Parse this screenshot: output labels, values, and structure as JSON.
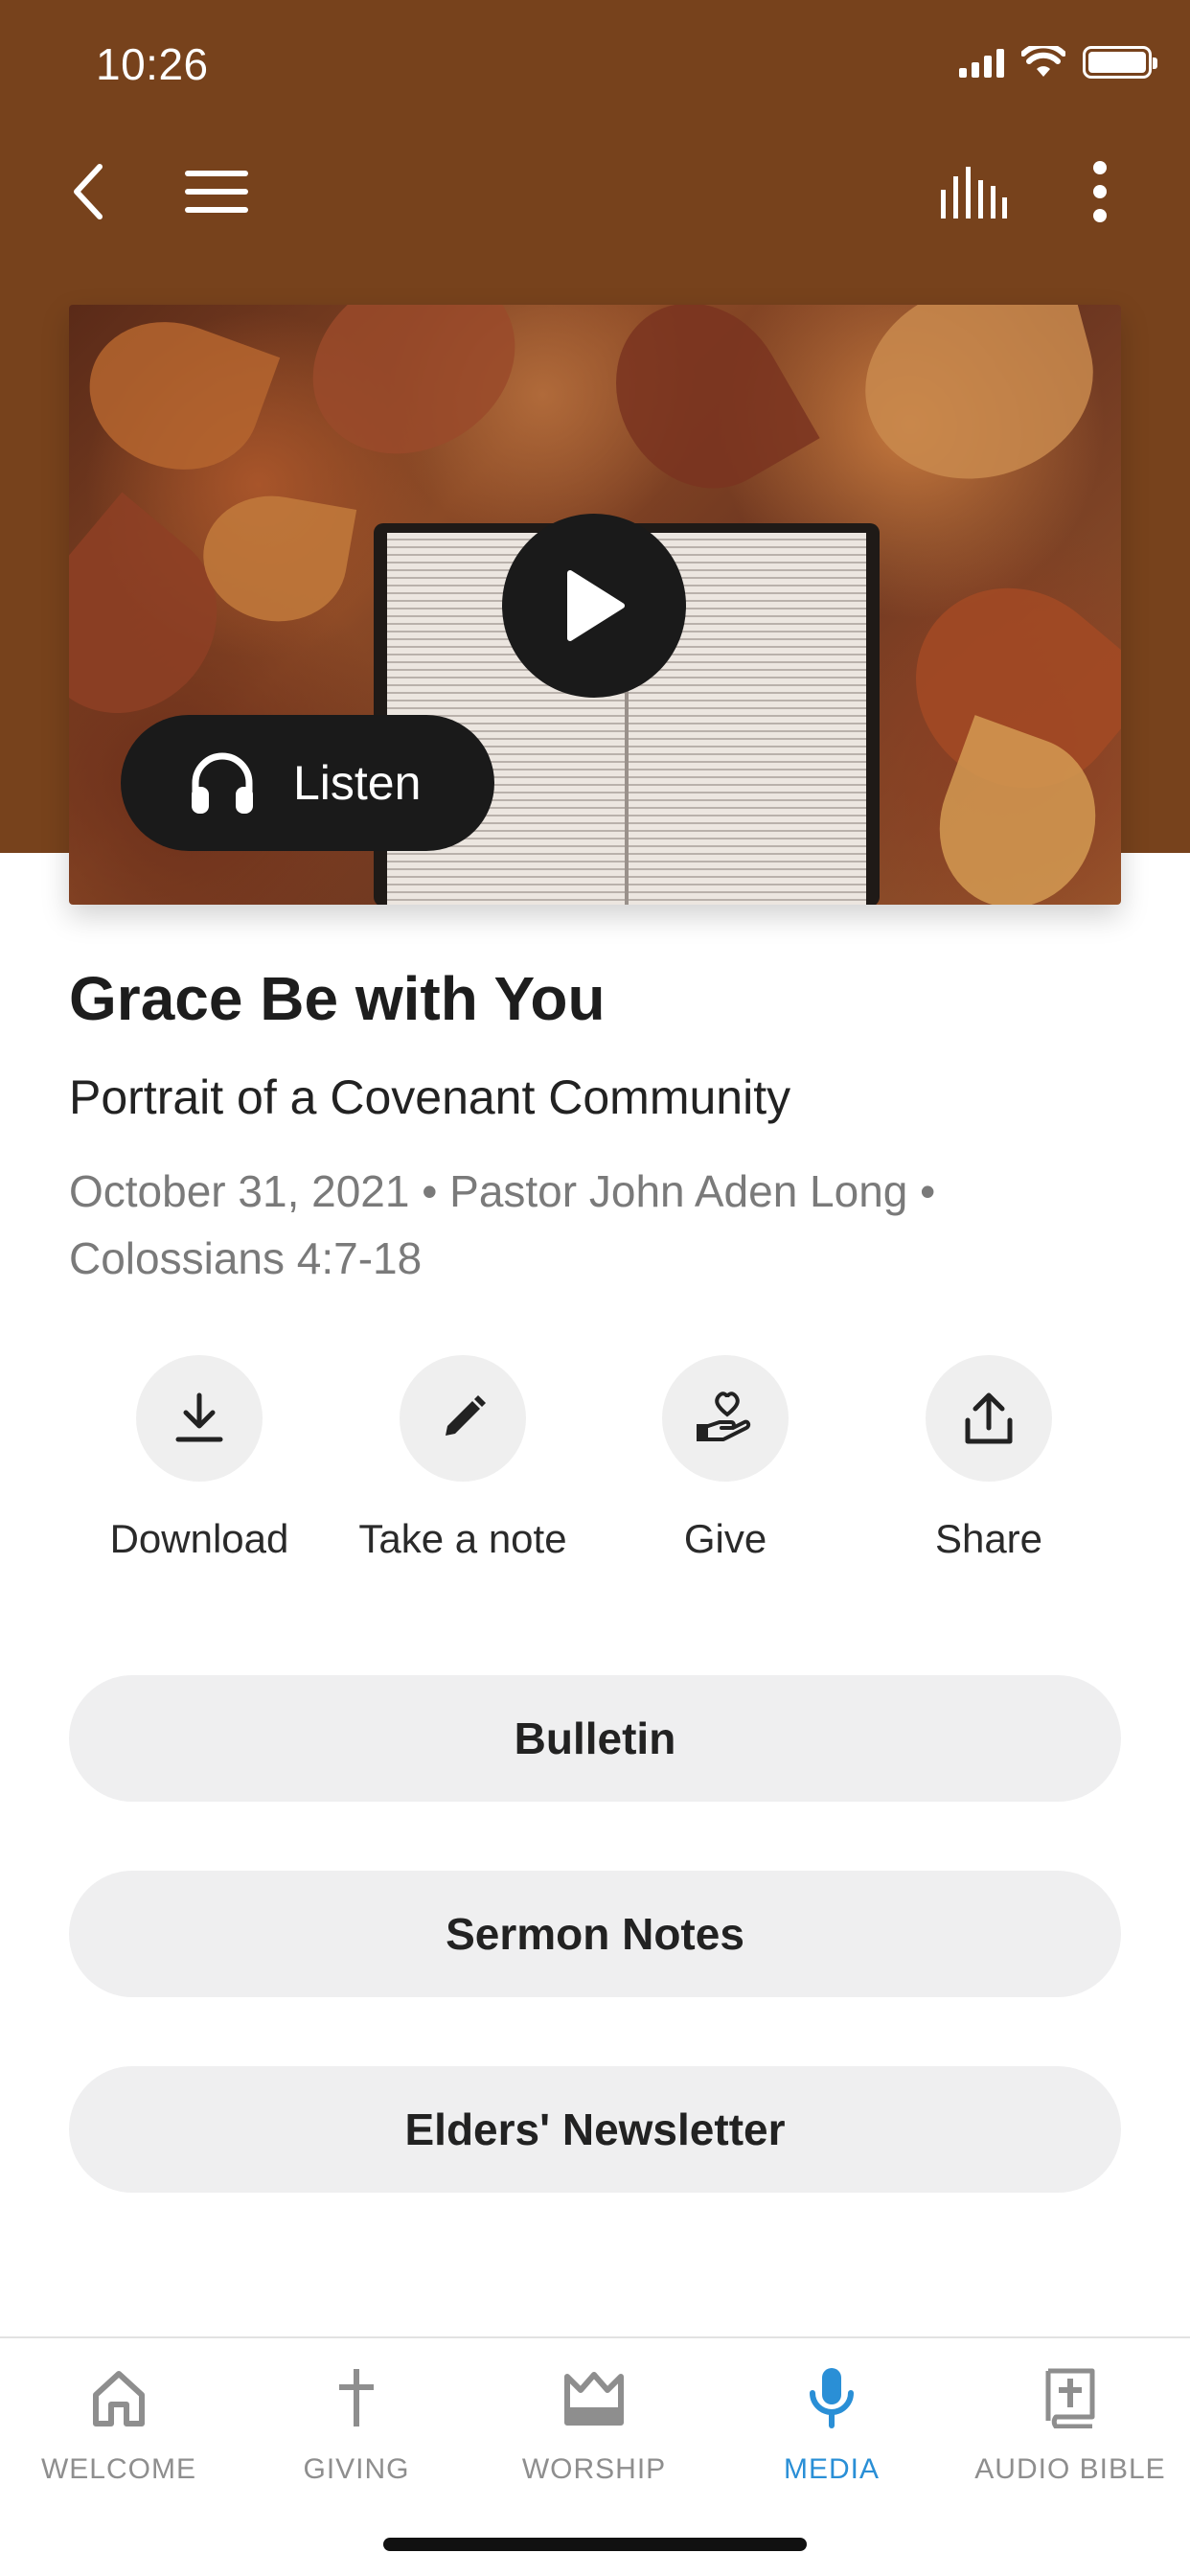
{
  "status_bar": {
    "time": "10:26"
  },
  "hero": {
    "listen_label": "Listen"
  },
  "sermon": {
    "title": "Grace Be with You",
    "subtitle": "Portrait of a Covenant Community",
    "meta": "October 31, 2021 • Pastor John Aden Long • Colossians 4:7-18"
  },
  "actions": [
    {
      "label": "Download",
      "icon": "download-icon"
    },
    {
      "label": "Take a note",
      "icon": "pencil-icon"
    },
    {
      "label": "Give",
      "icon": "give-heart-hand-icon"
    },
    {
      "label": "Share",
      "icon": "share-icon"
    }
  ],
  "links": [
    {
      "label": "Bulletin"
    },
    {
      "label": "Sermon Notes"
    },
    {
      "label": "Elders' Newsletter"
    }
  ],
  "tabs": [
    {
      "label": "WELCOME",
      "icon": "home-icon",
      "active": false
    },
    {
      "label": "GIVING",
      "icon": "cross-icon",
      "active": false
    },
    {
      "label": "WORSHIP",
      "icon": "crown-icon",
      "active": false
    },
    {
      "label": "MEDIA",
      "icon": "microphone-icon",
      "active": true
    },
    {
      "label": "AUDIO BIBLE",
      "icon": "bible-icon",
      "active": false
    }
  ],
  "colors": {
    "header_brown": "#77421c",
    "active_tab": "#2a8fd6",
    "inactive_tab": "#8e8e8e"
  }
}
